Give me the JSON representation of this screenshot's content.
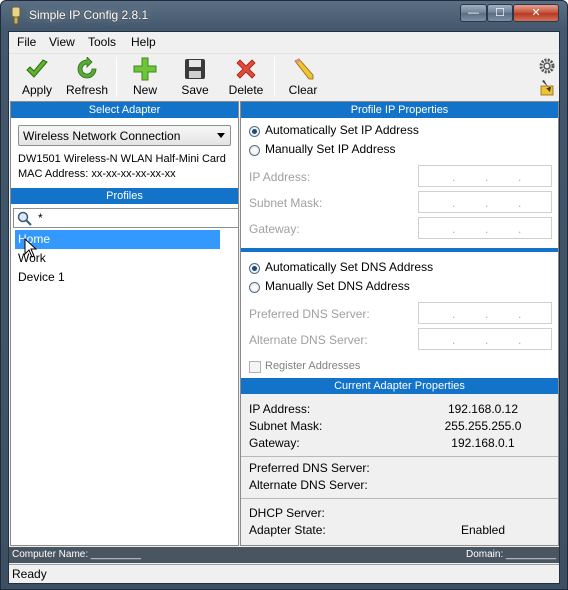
{
  "window": {
    "title": "Simple IP Config 2.8.1",
    "buttons": {
      "minimize": "—",
      "maximize": "☐",
      "close": "✕"
    }
  },
  "menu": [
    "File",
    "View",
    "Tools",
    "Help"
  ],
  "toolbar": {
    "apply": "Apply",
    "refresh": "Refresh",
    "new": "New",
    "save": "Save",
    "delete": "Delete",
    "clear": "Clear"
  },
  "select_adapter": {
    "header": "Select Adapter",
    "selected": "Wireless Network Connection",
    "description": "DW1501 Wireless-N WLAN Half-Mini Card",
    "mac": "MAC Address: xx-xx-xx-xx-xx-xx"
  },
  "profiles": {
    "header": "Profiles",
    "search_value": "*",
    "items": [
      "Home",
      "Work",
      "Device 1"
    ],
    "selected_index": 0
  },
  "profile_ip": {
    "header": "Profile IP Properties",
    "auto_ip": "Automatically Set IP Address",
    "manual_ip": "Manually Set IP Address",
    "ip_label": "IP Address:",
    "subnet_label": "Subnet Mask:",
    "gateway_label": "Gateway:",
    "auto_dns": "Automatically Set DNS Address",
    "manual_dns": "Manually Set DNS Address",
    "pref_dns_label": "Preferred DNS Server:",
    "alt_dns_label": "Alternate DNS Server:",
    "register": "Register Addresses",
    "dot": "."
  },
  "current": {
    "header": "Current Adapter Properties",
    "ip_label": "IP Address:",
    "ip": "192.168.0.12",
    "subnet_label": "Subnet Mask:",
    "subnet": "255.255.255.0",
    "gateway_label": "Gateway:",
    "gateway": "192.168.0.1",
    "pref_dns_label": "Preferred DNS Server:",
    "alt_dns_label": "Alternate DNS Server:",
    "dhcp_label": "DHCP Server:",
    "state_label": "Adapter State:",
    "state": "Enabled"
  },
  "footer": {
    "computer_name": "Computer Name: _________",
    "domain": "Domain: _________",
    "status": "Ready"
  },
  "colors": {
    "header_blue": "#1273c9",
    "selection": "#3399ff"
  }
}
